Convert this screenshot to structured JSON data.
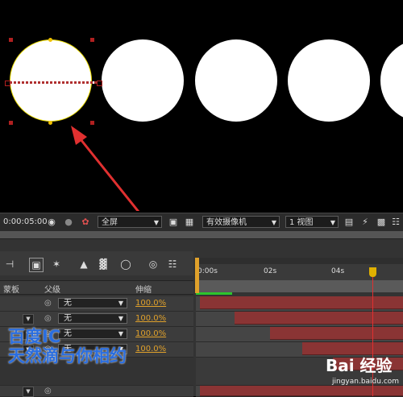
{
  "viewer_toolbar": {
    "timecode": "0:00:05:00",
    "camera_icon": "camera-icon",
    "magnification": "全屏",
    "active_camera": "有效摄像机",
    "view_layout": "1 视图"
  },
  "timeline": {
    "column_headers": {
      "trkmat": "蒙板",
      "parent": "父级",
      "stretch": "伸缩"
    },
    "ruler_ticks": [
      "0:00s",
      "02s",
      "04s"
    ],
    "rows": [
      {
        "parent": "无",
        "stretch": "100.0%"
      },
      {
        "parent": "无",
        "stretch": "100.0%"
      },
      {
        "parent": "无",
        "stretch": "100.0%"
      },
      {
        "parent": "无",
        "stretch": "100.0%"
      }
    ]
  },
  "watermark": {
    "line1": "百度IC",
    "line2": "天然滴与你相约",
    "logo": "Bai 经验",
    "url": "jingyan.baidu.com"
  },
  "colors": {
    "accent_orange": "#e0a12b",
    "selection_yellow": "#f0e000",
    "annotation_red": "#e03030",
    "bar_red": "#8a3434"
  }
}
